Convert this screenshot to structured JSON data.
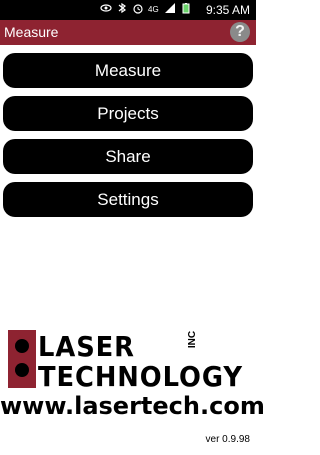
{
  "status_bar": {
    "time": "9:35 AM",
    "icons": [
      "eye-icon",
      "bluetooth-icon",
      "alarm-icon",
      "4g-icon",
      "signal-icon",
      "battery-icon"
    ]
  },
  "app_bar": {
    "title": "Measure",
    "help_icon": "question-icon"
  },
  "menu": {
    "items": [
      {
        "label": "Measure"
      },
      {
        "label": "Projects"
      },
      {
        "label": "Share"
      },
      {
        "label": "Settings"
      }
    ]
  },
  "branding": {
    "logo_line1": "LASER",
    "logo_inc": "INC",
    "logo_line2": "TECHNOLOGY",
    "url": "www.lasertech.com",
    "brand_color": "#8e2331"
  },
  "footer": {
    "version": "ver 0.9.98"
  }
}
